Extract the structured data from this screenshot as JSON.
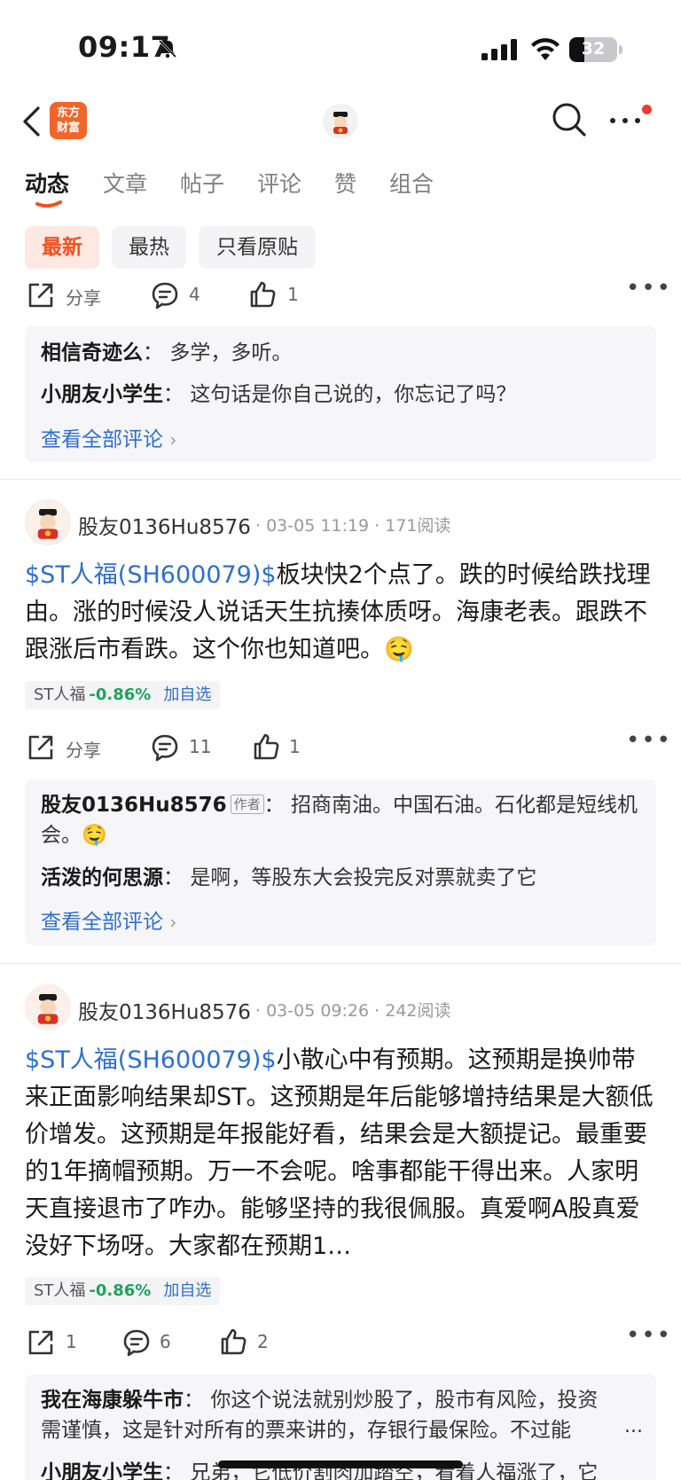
{
  "status_bar": {
    "time": "09:17",
    "battery": "32"
  },
  "nav": {
    "logo_text_line1": "东方",
    "logo_text_line2": "财富"
  },
  "tabs": [
    {
      "label": "动态",
      "active": true
    },
    {
      "label": "文章"
    },
    {
      "label": "帖子"
    },
    {
      "label": "评论"
    },
    {
      "label": "赞"
    },
    {
      "label": "组合"
    }
  ],
  "filters": [
    {
      "label": "最新",
      "active": true
    },
    {
      "label": "最热"
    },
    {
      "label": "只看原贴"
    }
  ],
  "post0": {
    "actions": {
      "share": "分享",
      "comments": "4",
      "likes": "1"
    },
    "comments": [
      {
        "name": "相信奇迹么",
        "sep": "：",
        "text": "多学，多听。"
      },
      {
        "name": "小朋友小学生",
        "sep": "：",
        "text": "这句话是你自己说的，你忘记了吗？"
      }
    ],
    "view_all": "查看全部评论"
  },
  "post1": {
    "user": "股友0136Hu8576",
    "time": "03-05 11:19",
    "reads": "171阅读",
    "stock_link": "$ST人福(SH600079)$",
    "text": "板块快2个点了。跌的时候给跌找理由。涨的时候没人说话天生抗揍体质呀。海康老表。跟跌不跟涨后市看跌。这个你也知道吧。🤤",
    "tag": {
      "name": "ST人福",
      "change": "-0.86%",
      "add": "加自选"
    },
    "actions": {
      "share": "分享",
      "comments": "11",
      "likes": "1"
    },
    "comments": [
      {
        "name": "股友0136Hu8576",
        "author_tag": "作者",
        "sep": "：",
        "text": "招商南油。中国石油。石化都是短线机会。🤤"
      },
      {
        "name": "活泼的何思源",
        "sep": "：",
        "text": "是啊，等股东大会投完反对票就卖了它"
      }
    ],
    "view_all": "查看全部评论"
  },
  "post2": {
    "user": "股友0136Hu8576",
    "time": "03-05 09:26",
    "reads": "242阅读",
    "stock_link": "$ST人福(SH600079)$",
    "text": "小散心中有预期。这预期是换帅带来正面影响结果却ST。这预期是年后能够增持结果是大额低价增发。这预期是年报能好看，结果会是大额提记。最重要的1年摘帽预期。万一不会呢。啥事都能干得出来。人家明天直接退市了咋办。能够坚持的我很佩服。真爱啊A股真爱没好下场呀。大家都在预期1…",
    "tag": {
      "name": "ST人福",
      "change": "-0.86%",
      "add": "加自选"
    },
    "actions": {
      "share": "1",
      "comments": "6",
      "likes": "2"
    },
    "comments": [
      {
        "name": "我在海康躲牛市",
        "sep": "：",
        "text": "你这个说法就别炒股了，股市有风险，投资需谨慎，这是针对所有的票来讲的，存银行最保险。不过能",
        "more": "..."
      },
      {
        "name": "小朋友小学生",
        "sep": "：",
        "text": "兄弟，它低价割肉加踏空，看着人福涨了，它"
      }
    ]
  }
}
